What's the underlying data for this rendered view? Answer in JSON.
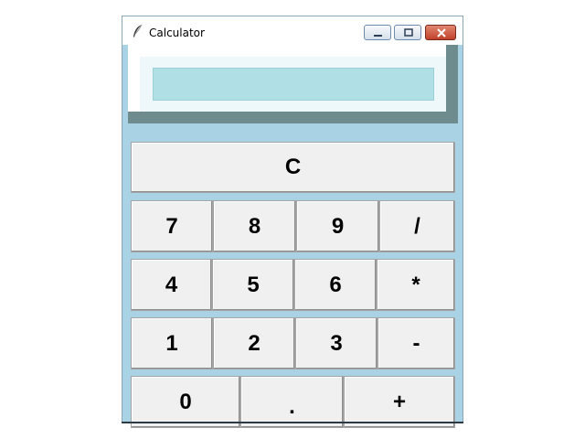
{
  "window": {
    "title": "Calculator",
    "icon": "feather-icon",
    "controls": [
      "minimize-icon",
      "maximize-icon",
      "close-icon"
    ]
  },
  "display": {
    "value": ""
  },
  "buttons": {
    "clear": "C",
    "row1": [
      "7",
      "8",
      "9",
      "/"
    ],
    "row2": [
      "4",
      "5",
      "6",
      "*"
    ],
    "row3": [
      "1",
      "2",
      "3",
      "-"
    ],
    "row4": [
      "0",
      ".",
      "+"
    ]
  },
  "colors": {
    "background": "#a9d3e4",
    "display_bg": "#b0e0e6",
    "display_border": "#6e8b8e",
    "button_bg": "#f0f0f0"
  }
}
